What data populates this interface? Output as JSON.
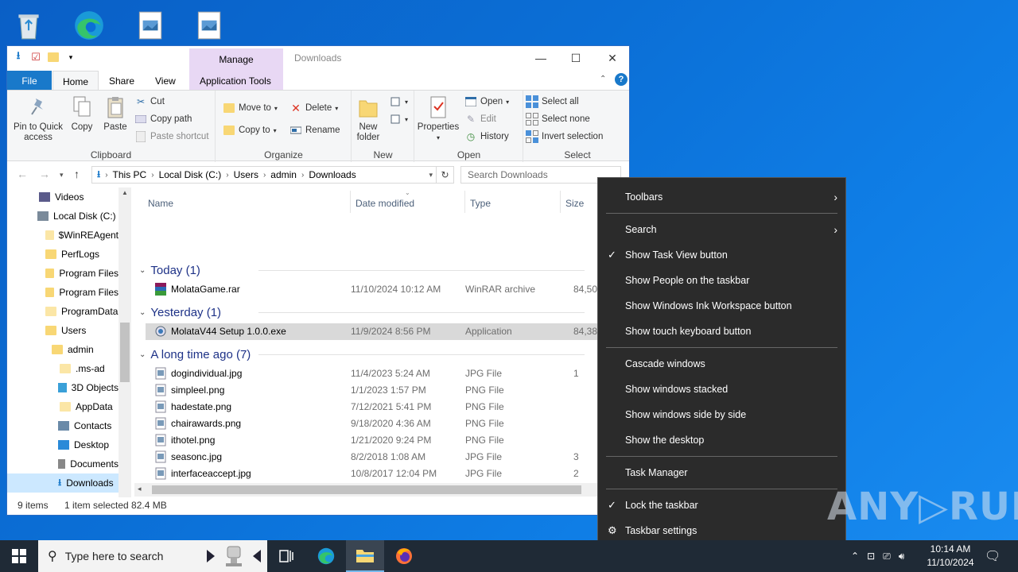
{
  "window": {
    "title": "Downloads",
    "manage_tab": "Manage",
    "min": "—",
    "max": "☐",
    "close": "✕"
  },
  "ribbon_tabs": [
    "File",
    "Home",
    "Share",
    "View",
    "Application Tools"
  ],
  "ribbon": {
    "clipboard": {
      "label": "Clipboard",
      "pin": "Pin to Quick access",
      "copy": "Copy",
      "paste": "Paste",
      "cut": "Cut",
      "copy_path": "Copy path",
      "paste_shortcut": "Paste shortcut"
    },
    "organize": {
      "label": "Organize",
      "move_to": "Move to",
      "copy_to": "Copy to",
      "delete": "Delete",
      "rename": "Rename"
    },
    "new": {
      "label": "New",
      "new_folder": "New folder"
    },
    "open": {
      "label": "Open",
      "properties": "Properties",
      "open": "Open",
      "edit": "Edit",
      "history": "History"
    },
    "select": {
      "label": "Select",
      "select_all": "Select all",
      "select_none": "Select none",
      "invert": "Invert selection"
    }
  },
  "address": {
    "crumbs": [
      "This PC",
      "Local Disk (C:)",
      "Users",
      "admin",
      "Downloads"
    ],
    "search_placeholder": "Search Downloads"
  },
  "nav_pane": [
    {
      "label": "Videos",
      "icon": "videos-icon"
    },
    {
      "label": "Local Disk (C:)",
      "icon": "drive-icon"
    },
    {
      "label": "$WinREAgent",
      "icon": "folder-icon"
    },
    {
      "label": "PerfLogs",
      "icon": "folder-icon"
    },
    {
      "label": "Program Files",
      "icon": "folder-icon"
    },
    {
      "label": "Program Files",
      "icon": "folder-icon"
    },
    {
      "label": "ProgramData",
      "icon": "folder-icon"
    },
    {
      "label": "Users",
      "icon": "folder-icon"
    },
    {
      "label": "admin",
      "icon": "folder-icon"
    },
    {
      "label": ".ms-ad",
      "icon": "folder-icon"
    },
    {
      "label": "3D Objects",
      "icon": "3d-objects-icon"
    },
    {
      "label": "AppData",
      "icon": "folder-icon"
    },
    {
      "label": "Contacts",
      "icon": "contacts-icon"
    },
    {
      "label": "Desktop",
      "icon": "desktop-icon"
    },
    {
      "label": "Documents",
      "icon": "documents-icon"
    },
    {
      "label": "Downloads",
      "icon": "downloads-icon"
    }
  ],
  "columns": {
    "name": "Name",
    "date": "Date modified",
    "type": "Type",
    "size": "Size"
  },
  "groups": [
    {
      "title": "Today (1)",
      "files": [
        {
          "name": "MolataGame.rar",
          "date": "11/10/2024 10:12 AM",
          "type": "WinRAR archive",
          "size": "84,50"
        }
      ]
    },
    {
      "title": "Yesterday (1)",
      "files": [
        {
          "name": "MolataV44 Setup 1.0.0.exe",
          "date": "11/9/2024 8:56 PM",
          "type": "Application",
          "size": "84,38"
        }
      ]
    },
    {
      "title": "A long time ago (7)",
      "files": [
        {
          "name": "dogindividual.jpg",
          "date": "11/4/2023 5:24 AM",
          "type": "JPG File",
          "size": "1"
        },
        {
          "name": "simpleel.png",
          "date": "1/1/2023 1:57 PM",
          "type": "PNG File",
          "size": ""
        },
        {
          "name": "hadestate.png",
          "date": "7/12/2021 5:41 PM",
          "type": "PNG File",
          "size": ""
        },
        {
          "name": "chairawards.png",
          "date": "9/18/2020 4:36 AM",
          "type": "PNG File",
          "size": ""
        },
        {
          "name": "ithotel.png",
          "date": "1/21/2020 9:24 PM",
          "type": "PNG File",
          "size": ""
        },
        {
          "name": "seasonc.jpg",
          "date": "8/2/2018 1:08 AM",
          "type": "JPG File",
          "size": "3"
        },
        {
          "name": "interfaceaccept.jpg",
          "date": "10/8/2017 12:04 PM",
          "type": "JPG File",
          "size": "2"
        }
      ]
    }
  ],
  "status": {
    "count": "9 items",
    "selection": "1 item selected  82.4 MB"
  },
  "context_menu": {
    "toolbars": "Toolbars",
    "search": "Search",
    "show_task_view": "Show Task View button",
    "show_people": "Show People on the taskbar",
    "show_ink": "Show Windows Ink Workspace button",
    "show_touch_kb": "Show touch keyboard button",
    "cascade": "Cascade windows",
    "stacked": "Show windows stacked",
    "side_by_side": "Show windows side by side",
    "show_desktop": "Show the desktop",
    "task_manager": "Task Manager",
    "lock_taskbar": "Lock the taskbar",
    "taskbar_settings": "Taskbar settings",
    "check": "✓",
    "arrow": "›",
    "gear": "⚙"
  },
  "taskbar": {
    "search_placeholder": "Type here to search",
    "time": "10:14 AM",
    "date": "11/10/2024"
  },
  "watermark": "ANY▷RUN",
  "colors": {
    "accent": "#1979ca",
    "selected_row": "#d9d9d9",
    "menu_bg": "#2b2b2b",
    "taskbar": "#1f2a36"
  }
}
